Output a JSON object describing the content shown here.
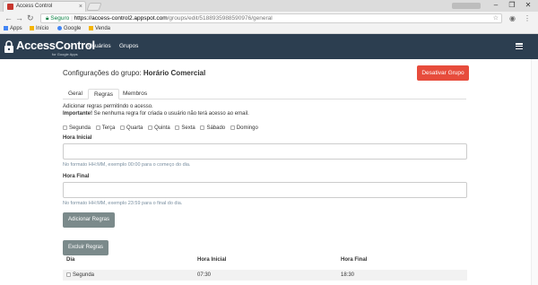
{
  "browser": {
    "tab_title": "Access Control",
    "tab_close": "×",
    "window_controls": [
      "–",
      "❐",
      "✕"
    ],
    "nav": {
      "back": "←",
      "forward": "→",
      "reload": "↻"
    },
    "address": {
      "secure_label": "Seguro",
      "host": "https://access-control2.appspot.com",
      "path": "/groups/edit/5188935988590976/general"
    },
    "bookmarks": [
      {
        "label": "Apps",
        "icon": "apps-grid-icon",
        "color": "#4285f4"
      },
      {
        "label": "Início",
        "icon": "folder-icon",
        "color": "#f4b400"
      },
      {
        "label": "Google",
        "icon": "google-icon",
        "color": "#4285f4"
      },
      {
        "label": "Venda",
        "icon": "folder-icon",
        "color": "#f4b400"
      }
    ]
  },
  "app": {
    "brand": "AccessControl",
    "brand_sub": "for Google Apps",
    "nav_links": [
      "Usuários",
      "Grupos"
    ],
    "navbar_color": "#2c3e50"
  },
  "page": {
    "title_prefix": "Configurações do grupo:",
    "group_name": "Horário Comercial",
    "deactivate_button": "Desativar Grupo",
    "tabs": [
      "Geral",
      "Regras",
      "Membros"
    ],
    "active_tab": "Regras",
    "intro": "Adicionar regras permitindo o acesso.",
    "important_label": "Importante!",
    "important_text": "Se nenhuma regra for criada o usuário não terá acesso ao email.",
    "days": [
      "Segunda",
      "Terça",
      "Quarta",
      "Quinta",
      "Sexta",
      "Sábado",
      "Domingo"
    ],
    "start_label": "Hora Inicial",
    "start_value": "",
    "start_help": "No formato HH:MM, exemplo 00:00 para o começo do dia.",
    "end_label": "Hora Final",
    "end_value": "",
    "end_help": "No formato HH:MM, exemplo 23:59 para o final do dia.",
    "add_button": "Adicionar Regras",
    "delete_button": "Excluir Regras",
    "table": {
      "headers": [
        "Dia",
        "Hora Inicial",
        "Hora Final"
      ],
      "rows": [
        {
          "day": "Segunda",
          "start": "07:30",
          "end": "18:30"
        }
      ]
    }
  }
}
